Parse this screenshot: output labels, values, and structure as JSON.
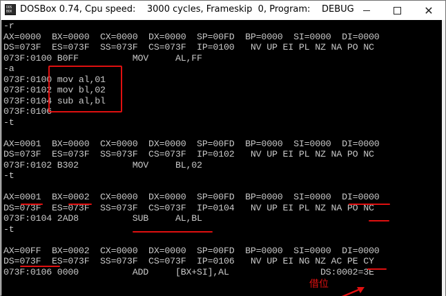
{
  "window": {
    "title": "DOSBox 0.74, Cpu speed:    3000 cycles, Frameskip  0, Program:    DEBUG",
    "icon_text_top": "DOS",
    "icon_text_bottom": "BOX",
    "minimize_icon": "minimize-icon",
    "maximize_icon": "maximize-icon",
    "close_icon": "close-icon",
    "close_glyph": "✕"
  },
  "console": {
    "lines": [
      "-r",
      "AX=0000  BX=0000  CX=0000  DX=0000  SP=00FD  BP=0000  SI=0000  DI=0000",
      "DS=073F  ES=073F  SS=073F  CS=073F  IP=0100   NV UP EI PL NZ NA PO NC",
      "073F:0100 B0FF          MOV     AL,FF",
      "-a",
      "073F:0100 mov al,01",
      "073F:0102 mov bl,02",
      "073F:0104 sub al,bl",
      "073F:0106",
      "-t",
      "",
      "AX=0001  BX=0000  CX=0000  DX=0000  SP=00FD  BP=0000  SI=0000  DI=0000",
      "DS=073F  ES=073F  SS=073F  CS=073F  IP=0102   NV UP EI PL NZ NA PO NC",
      "073F:0102 B302          MOV     BL,02",
      "-t",
      "",
      "AX=0001  BX=0002  CX=0000  DX=0000  SP=00FD  BP=0000  SI=0000  DI=0000",
      "DS=073F  ES=073F  SS=073F  CS=073F  IP=0104   NV UP EI PL NZ NA PO NC",
      "073F:0104 2AD8          SUB     AL,BL",
      "-t",
      "",
      "AX=00FF  BX=0002  CX=0000  DX=0000  SP=00FD  BP=0000  SI=0000  DI=0000",
      "DS=073F  ES=073F  SS=073F  CS=073F  IP=0106   NV UP EI NG NZ AC PE CY",
      "073F:0106 0000          ADD     [BX+SI],AL                 DS:0002=3E"
    ]
  },
  "annotations": {
    "borrow_label": "借位",
    "color": "#e01010"
  },
  "colors": {
    "console_bg": "#000000",
    "console_text": "#c8c8c8",
    "annotation": "#e01010"
  }
}
